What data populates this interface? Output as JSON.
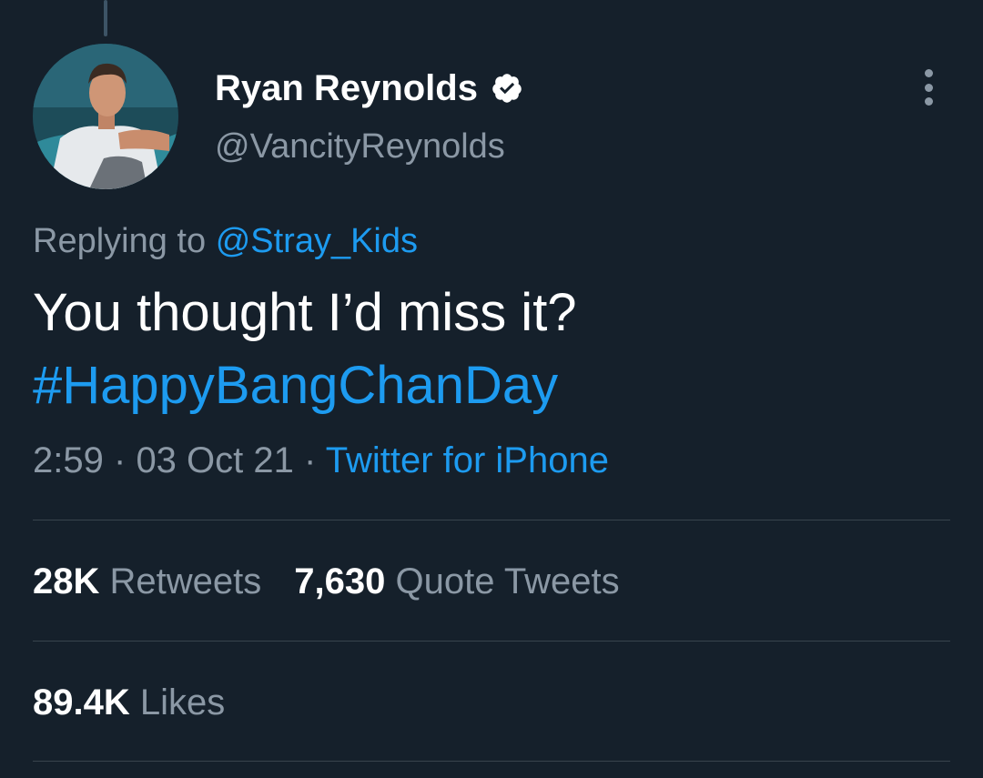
{
  "tweet": {
    "author": {
      "name": "Ryan Reynolds",
      "handle": "@VancityReynolds",
      "verified": true
    },
    "replying": {
      "prefix": "Replying to",
      "mention": "@Stray_Kids"
    },
    "text_line1": "You thought I’d miss it?",
    "hashtag": "#HappyBangChanDay",
    "time": "2:59",
    "date": "03 Oct 21",
    "separator": "·",
    "source": "Twitter for iPhone",
    "stats": {
      "retweets_count": "28K",
      "retweets_label": "Retweets",
      "quotes_count": "7,630",
      "quotes_label": "Quote Tweets",
      "likes_count": "89.4K",
      "likes_label": "Likes"
    }
  },
  "colors": {
    "background": "#15202b",
    "accent": "#1d9bf0",
    "secondary_text": "#8b98a5",
    "divider": "#38444d"
  },
  "icons": {
    "verified": "verified-badge-icon",
    "more": "more-vertical-icon"
  }
}
